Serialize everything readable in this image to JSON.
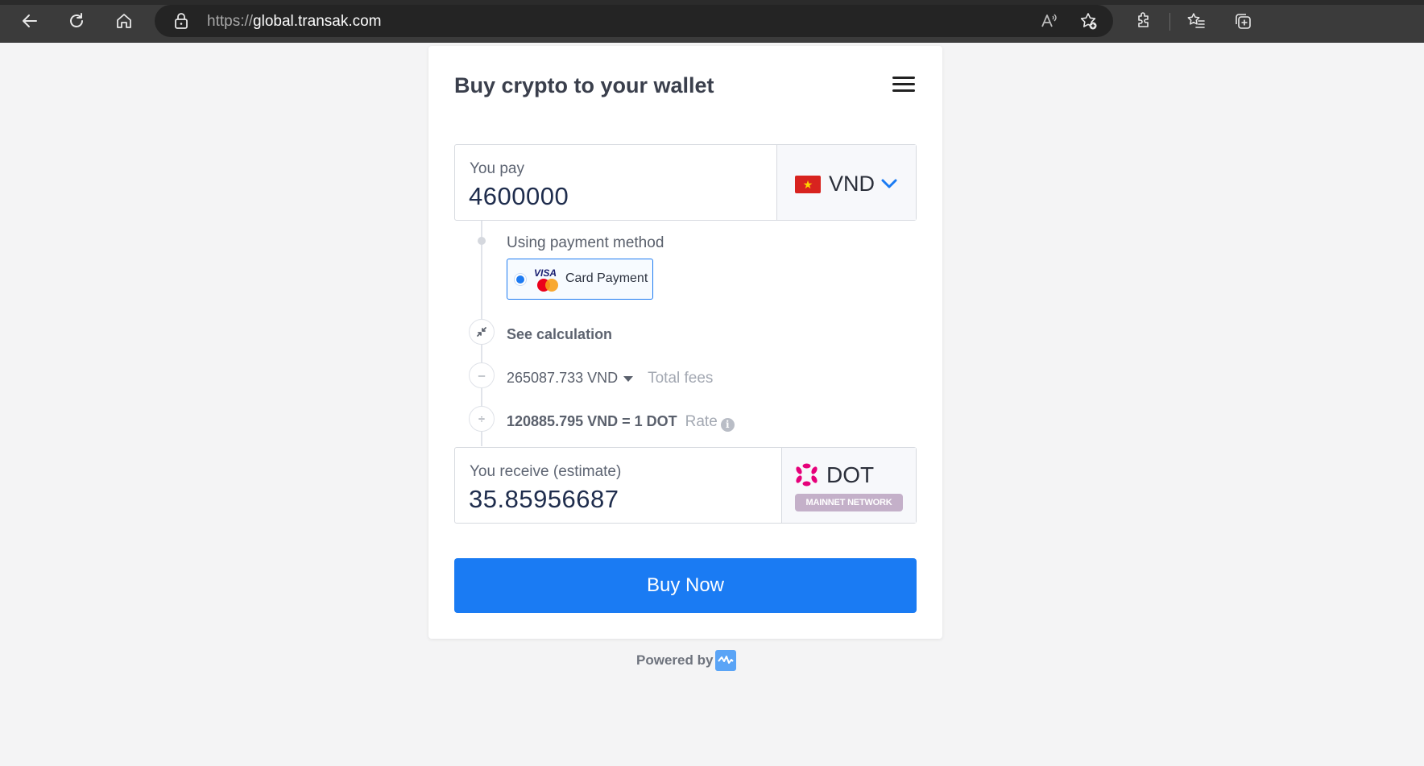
{
  "browser": {
    "url_protocol": "https://",
    "url_host": "global.transak.com"
  },
  "widget": {
    "title": "Buy crypto to your wallet",
    "pay": {
      "label": "You pay",
      "amount": "4600000",
      "currency": "VND"
    },
    "payment_method": {
      "label": "Using payment method",
      "option": "Card Payment",
      "brand": "VISA"
    },
    "calculation": {
      "toggle_label": "See calculation",
      "fees_value": "265087.733 VND",
      "fees_label": "Total fees",
      "rate_value": "120885.795 VND = 1 DOT",
      "rate_label": "Rate"
    },
    "receive": {
      "label": "You receive (estimate)",
      "amount": "35.85956687",
      "currency": "DOT",
      "network": "MAINNET NETWORK"
    },
    "buy_button": "Buy Now",
    "powered_by": "Powered by"
  },
  "colors": {
    "accent": "#1a7bf3",
    "polkadot": "#e6007a",
    "network_badge": "#c4b0c9"
  }
}
